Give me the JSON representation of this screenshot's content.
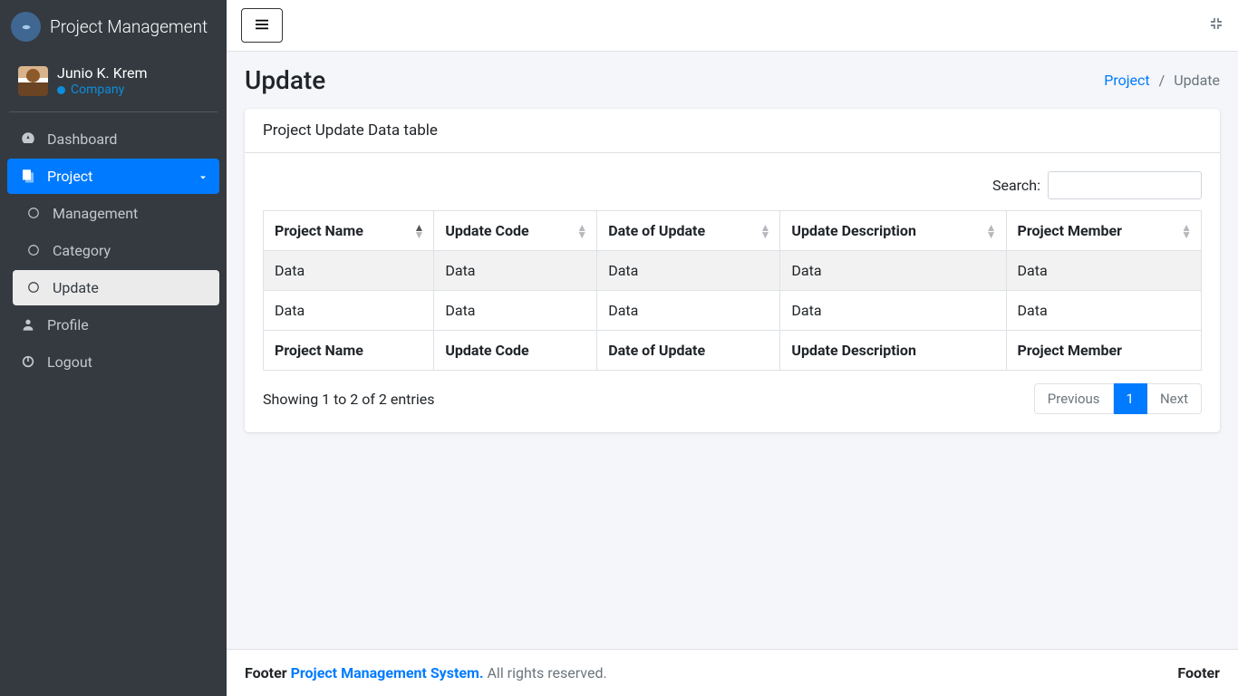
{
  "brand": {
    "title": "Project Management"
  },
  "user": {
    "name": "Junio K. Krem",
    "role": "Company"
  },
  "sidebar": {
    "items": [
      {
        "label": "Dashboard"
      },
      {
        "label": "Project"
      },
      {
        "label": "Management"
      },
      {
        "label": "Category"
      },
      {
        "label": "Update"
      },
      {
        "label": "Profile"
      },
      {
        "label": "Logout"
      }
    ]
  },
  "header": {
    "title": "Update",
    "breadcrumb_link": "Project",
    "breadcrumb_current": "Update"
  },
  "card": {
    "title": "Project Update Data table",
    "search_label": "Search:",
    "columns": [
      "Project Name",
      "Update Code",
      "Date of Update",
      "Update Description",
      "Project Member"
    ],
    "rows": [
      [
        "Data",
        "Data",
        "Data",
        "Data",
        "Data"
      ],
      [
        "Data",
        "Data",
        "Data",
        "Data",
        "Data"
      ]
    ],
    "info_text": "Showing 1 to 2 of 2 entries",
    "pagination": {
      "prev": "Previous",
      "pages": [
        "1"
      ],
      "next": "Next"
    }
  },
  "footer": {
    "left_prefix": "Footer ",
    "link": "Project Management System.",
    "rights": " All rights reserved.",
    "right": "Footer"
  }
}
